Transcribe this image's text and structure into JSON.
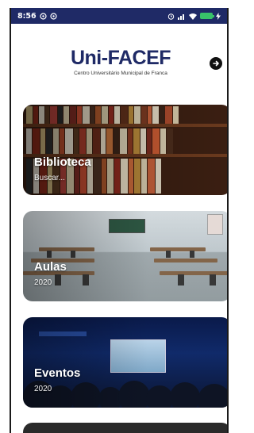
{
  "status_bar": {
    "time": "8:56",
    "icons_left": [
      "circle-notification-icon",
      "circle-notification-icon"
    ],
    "icons_right": [
      "alarm-icon",
      "signal-icon",
      "wifi-icon",
      "battery-icon",
      "charging-icon"
    ]
  },
  "header": {
    "logo_title": "Uni-FACEF",
    "logo_subtitle": "Centro Universitário Municipal de Franca",
    "nav_icon": "arrow-right-circle-icon"
  },
  "cards": [
    {
      "id": "biblioteca",
      "title": "Biblioteca",
      "subtitle": "Buscar..."
    },
    {
      "id": "aulas",
      "title": "Aulas",
      "subtitle": "2020"
    },
    {
      "id": "eventos",
      "title": "Eventos",
      "subtitle": "2020"
    }
  ],
  "colors": {
    "brand": "#1f2a66",
    "status_bar": "#1f2a66",
    "battery": "#38c26a"
  }
}
